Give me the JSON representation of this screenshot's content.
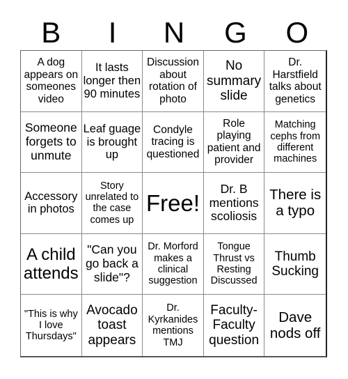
{
  "header": {
    "letters": [
      "B",
      "I",
      "N",
      "G",
      "O"
    ]
  },
  "board": {
    "rows": [
      [
        {
          "text": "A dog appears on someones video"
        },
        {
          "text": "It lasts longer then 90 minutes"
        },
        {
          "text": "Discussion about rotation of photo"
        },
        {
          "text": "No summary slide"
        },
        {
          "text": "Dr. Harstfield talks about genetics"
        }
      ],
      [
        {
          "text": "Someone forgets to unmute"
        },
        {
          "text": "Leaf guage is brought up"
        },
        {
          "text": "Condyle tracing is questioned"
        },
        {
          "text": "Role playing patient and provider"
        },
        {
          "text": "Matching cephs from different machines"
        }
      ],
      [
        {
          "text": "Accessory in photos"
        },
        {
          "text": "Story unrelated to the case comes up"
        },
        {
          "text": "Free!"
        },
        {
          "text": "Dr. B mentions scoliosis"
        },
        {
          "text": "There is a typo"
        }
      ],
      [
        {
          "text": "A child attends"
        },
        {
          "text": "\"Can you go back a slide\"?"
        },
        {
          "text": "Dr. Morford makes a clinical suggestion"
        },
        {
          "text": "Tongue Thrust vs Resting Discussed"
        },
        {
          "text": "Thumb Sucking"
        }
      ],
      [
        {
          "text": "\"This is why I love Thursdays\""
        },
        {
          "text": "Avocado toast appears"
        },
        {
          "text": "Dr. Kyrkanides mentions TMJ"
        },
        {
          "text": "Faculty-Faculty question"
        },
        {
          "text": "Dave nods off"
        }
      ]
    ]
  }
}
